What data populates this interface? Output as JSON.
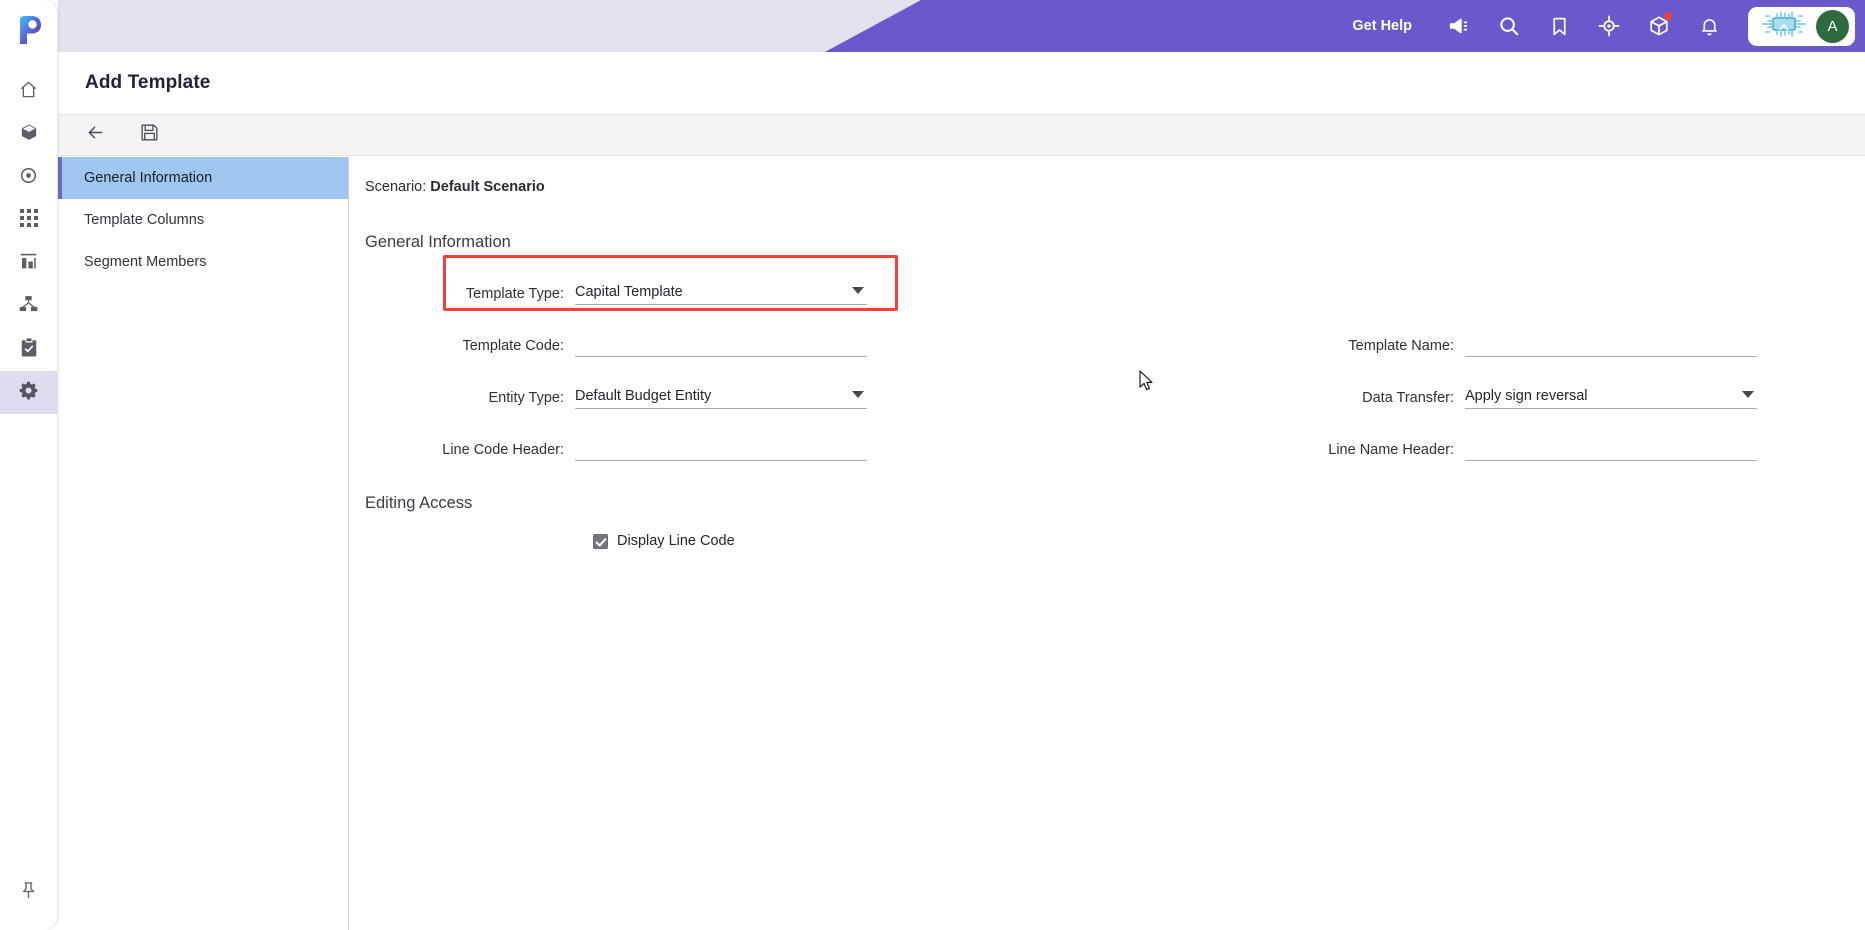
{
  "app": {
    "logo_icon": "pulse-logo-icon",
    "page_title": "Add Template"
  },
  "sidebar": {
    "items": [
      {
        "icon": "home-icon",
        "name": "home"
      },
      {
        "icon": "cube-icon",
        "name": "models"
      },
      {
        "icon": "target-icon",
        "name": "targets"
      },
      {
        "icon": "grid-icon",
        "name": "grid"
      },
      {
        "icon": "bar-chart-icon",
        "name": "reports"
      },
      {
        "icon": "hierarchy-icon",
        "name": "hierarchy"
      },
      {
        "icon": "clipboard-check-icon",
        "name": "tasks"
      },
      {
        "icon": "gear-icon",
        "name": "settings",
        "active": true
      }
    ],
    "bottom": {
      "icon": "pushpin-icon",
      "name": "pin-sidebar"
    }
  },
  "header": {
    "get_help_label": "Get Help",
    "icons": [
      {
        "name": "megaphone-icon",
        "glyph": "announcements"
      },
      {
        "name": "search-icon",
        "glyph": "search"
      },
      {
        "name": "bookmark-icon",
        "glyph": "bookmark"
      },
      {
        "name": "target-icon",
        "glyph": "focus"
      },
      {
        "name": "cube-icon",
        "glyph": "package",
        "badge": true
      },
      {
        "name": "bell-icon",
        "glyph": "notifications"
      }
    ],
    "ai_assistant_icon": "ai-chip-icon",
    "avatar_initial": "A",
    "colors": {
      "header_purple": "#6a58cc",
      "header_lavender": "#e4e0ec",
      "avatar_green": "#2d6b3f",
      "badge_red": "#ef4136"
    }
  },
  "toolbar": {
    "buttons": [
      {
        "name": "back-button",
        "icon": "arrow-left-icon"
      },
      {
        "name": "save-button",
        "icon": "floppy-disk-icon"
      }
    ]
  },
  "left_panel": {
    "items": [
      {
        "label": "General Information",
        "active": true
      },
      {
        "label": "Template Columns",
        "active": false
      },
      {
        "label": "Segment Members",
        "active": false
      }
    ]
  },
  "main": {
    "scenario_label": "Scenario:",
    "scenario_value": "Default Scenario",
    "general_information_heading": "General Information",
    "editing_access_heading": "Editing Access",
    "fields": {
      "template_type": {
        "label": "Template Type:",
        "value": "Capital Template",
        "type": "select",
        "highlighted": true
      },
      "template_name": {
        "label": "Template Name:",
        "value": "",
        "type": "text"
      },
      "template_code": {
        "label": "Template Code:",
        "value": "",
        "type": "text"
      },
      "data_transfer": {
        "label": "Data Transfer:",
        "value": "Apply sign reversal",
        "type": "select"
      },
      "entity_type": {
        "label": "Entity Type:",
        "value": "Default Budget Entity",
        "type": "select"
      },
      "line_code_header": {
        "label": "Line Code Header:",
        "value": "",
        "type": "text"
      },
      "line_name_header": {
        "label": "Line Name Header:",
        "value": "",
        "type": "text"
      }
    },
    "checkbox": {
      "label": "Display Line Code",
      "checked": true
    },
    "annotation": {
      "highlight_color": "#ef4137"
    }
  }
}
